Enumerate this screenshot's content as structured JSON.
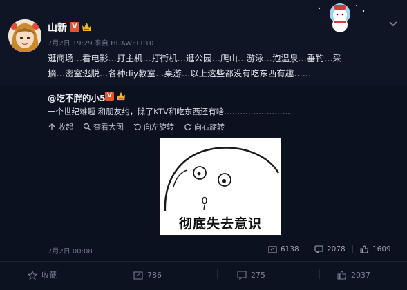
{
  "post": {
    "username": "山新",
    "verified_badge": "V",
    "meta": "7月2日 19:29 来自 HUAWEI P10",
    "text_line1": "逛商场…看电影…打主机…打街机…逛公园…爬山…游泳…泡温泉…垂钓…采",
    "text_line2": "摘…密室逃脱…各种diy教室…桌游…以上这些都没有吃东西有趣……",
    "icons": {
      "avatar": "avatar-illustration",
      "crown": "crown-icon",
      "menu": "chevron-down-icon",
      "art": "snowman-card-icon"
    }
  },
  "repost": {
    "user": "@吃不胖的小5",
    "verified_badge": "V",
    "text": "一个世纪难题 和朋友约，除了KTV和吃东西还有啥…………………….",
    "image_actions": [
      {
        "label": "收起",
        "icon": "collapse-icon"
      },
      {
        "label": "查看大图",
        "icon": "zoom-icon"
      },
      {
        "label": "向左旋转",
        "icon": "rotate-left-icon"
      },
      {
        "label": "向右旋转",
        "icon": "rotate-right-icon"
      }
    ],
    "meme_caption": "彻底失去意识",
    "time": "7月2日 00:08",
    "stats": [
      {
        "value": "6138",
        "icon": "share-icon"
      },
      {
        "value": "2078",
        "icon": "comment-icon"
      },
      {
        "value": "1609",
        "icon": "like-icon"
      }
    ]
  },
  "bottom_bar": {
    "items": [
      {
        "label": "收藏",
        "icon": "star-icon"
      },
      {
        "label": "786",
        "icon": "share-icon"
      },
      {
        "label": "275",
        "icon": "comment-icon"
      },
      {
        "label": "2037",
        "icon": "like-icon"
      }
    ]
  },
  "colors": {
    "background": "#0f1424",
    "badge": "#e8542d",
    "text": "#dcdfe6",
    "muted": "#6d7387"
  }
}
